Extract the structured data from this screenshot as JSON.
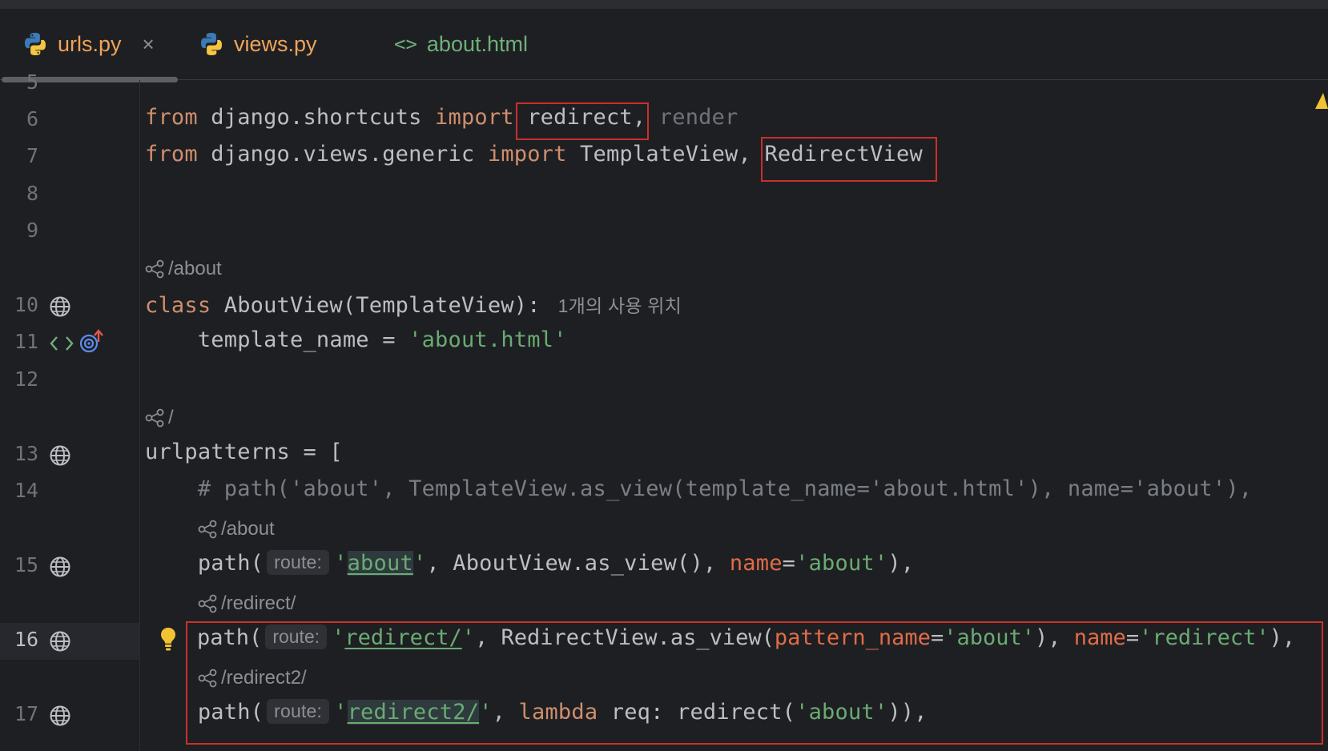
{
  "tabs": [
    {
      "label": "urls.py",
      "icon": "python-icon",
      "active": true,
      "close": "×"
    },
    {
      "label": "views.py",
      "icon": "python-icon",
      "active": false
    },
    {
      "label": "about.html",
      "icon": "html-icon",
      "active": false
    }
  ],
  "line_numbers": {
    "l5": "5",
    "l6": "6",
    "l7": "7",
    "l8": "8",
    "l9": "9",
    "l10": "10",
    "l11": "11",
    "l12": "12",
    "l13": "13",
    "l14": "14",
    "l15": "15",
    "l16": "16",
    "l17": "17"
  },
  "code": {
    "l6": {
      "kw1": "from",
      "mod": " django.shortcuts ",
      "kw2": "import",
      "name1": " redirect,",
      "name2": " render"
    },
    "l7": {
      "kw1": "from",
      "mod": " django.views.generic ",
      "kw2": "import",
      "name1": " TemplateView, ",
      "name2": "RedirectView"
    },
    "route_about_1": "/about",
    "l10": {
      "kw": "class",
      "rest": " AboutView(TemplateView):",
      "usage": "1개의 사용 위치"
    },
    "l11": {
      "indent": "    ",
      "name": "template_name = ",
      "str": "'about.html'"
    },
    "route_root": "/",
    "l13": "urlpatterns = [",
    "l14": "    # path('about', TemplateView.as_view(template_name='about.html'), name='about'),",
    "route_about_2": "/about",
    "l15": {
      "indent": "    ",
      "p1": "path(",
      "hint": "route:",
      "q1": "'",
      "s1": "about",
      "q2": "'",
      "mid": ", AboutView.as_view(), ",
      "kw": "name",
      "eq": "=",
      "s2": "'about'",
      "end": "),"
    },
    "route_redirect": "/redirect/",
    "l16": {
      "indent": "    ",
      "p1": "path(",
      "hint": "route:",
      "q1": "'",
      "s1": "redirect/",
      "q2": "'",
      "mid": ", RedirectView.as_view(",
      "kw1": "pattern_name",
      "eq1": "=",
      "s2": "'about'",
      "mid2": "), ",
      "kw2": "name",
      "eq2": "=",
      "s3": "'redirect'",
      "end": "),"
    },
    "route_redirect2": "/redirect2/",
    "l17": {
      "indent": "    ",
      "p1": "path(",
      "hint": "route:",
      "q1": "'",
      "s1": "redirect2/",
      "q2": "'",
      "mid": ", ",
      "kw": "lambda",
      "mid2": " req: redirect(",
      "s2": "'about'",
      "end": ")),"
    }
  },
  "colors": {
    "highlight_box": "#c8302c",
    "keyword": "#cf8e6d",
    "string": "#6aab73"
  }
}
